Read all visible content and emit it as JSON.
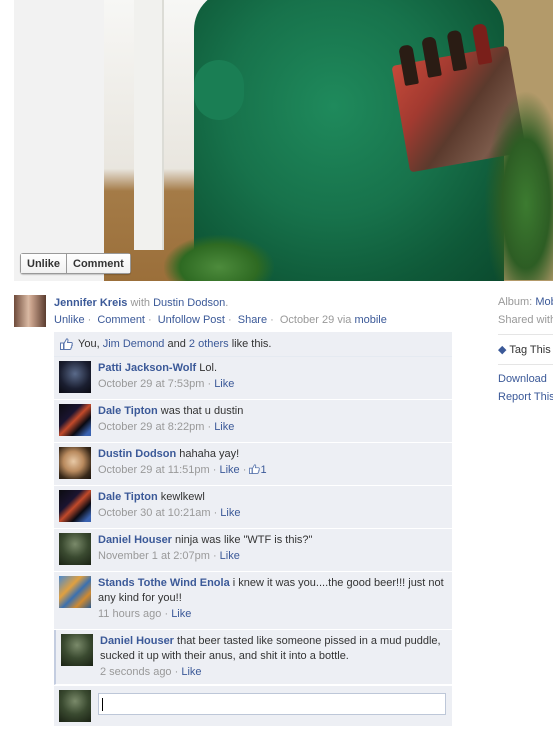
{
  "photo_actions": {
    "unlike": "Unlike",
    "comment": "Comment"
  },
  "post": {
    "author": "Jennifer Kreis",
    "with_text": "with",
    "tagged": "Dustin Dodson",
    "period": ".",
    "actions": [
      "Unlike",
      "Comment",
      "Unfollow Post",
      "Share"
    ],
    "date": "October 29",
    "via": "via",
    "source": "mobile"
  },
  "sidebar": {
    "album_label": "Album:",
    "album_value": "Mob",
    "shared": "Shared with",
    "tag": "Tag This",
    "download": "Download",
    "report": "Report This"
  },
  "likes": {
    "you": "You,",
    "person": "Jim Demond",
    "and": "and",
    "others": "2 others",
    "suffix": "like this."
  },
  "comments": [
    {
      "name": "Patti Jackson-Wolf",
      "text": "Lol.",
      "time": "October 29 at 7:53pm",
      "like": "Like",
      "count": ""
    },
    {
      "name": "Dale Tipton",
      "text": "was that u dustin",
      "time": "October 29 at 8:22pm",
      "like": "Like",
      "count": ""
    },
    {
      "name": "Dustin Dodson",
      "text": "hahaha yay!",
      "time": "October 29 at 11:51pm",
      "like": "Like",
      "count": "1"
    },
    {
      "name": "Dale Tipton",
      "text": "kewlkewl",
      "time": "October 30 at 10:21am",
      "like": "Like",
      "count": ""
    },
    {
      "name": "Daniel Houser",
      "text": "ninja was like \"WTF is this?\"",
      "time": "November 1 at 2:07pm",
      "like": "Like",
      "count": ""
    },
    {
      "name": "Stands Tothe Wind Enola",
      "text": "i knew it was you....the good beer!!! just not any kind for you!!",
      "time": "11 hours ago",
      "like": "Like",
      "count": ""
    },
    {
      "name": "Daniel Houser",
      "text": "that beer tasted like someone pissed in a mud puddle, sucked it up with their anus, and shit it into a bottle.",
      "time": "2 seconds ago",
      "like": "Like",
      "count": ""
    }
  ],
  "reply": {
    "value": ""
  }
}
